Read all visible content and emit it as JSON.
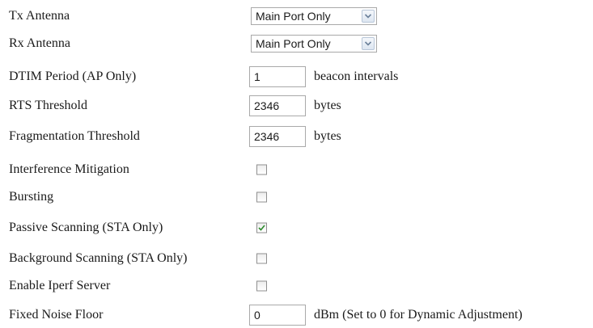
{
  "settings": {
    "tx_antenna": {
      "label": "Tx Antenna",
      "value": "Main Port Only"
    },
    "rx_antenna": {
      "label": "Rx Antenna",
      "value": "Main Port Only"
    },
    "dtim_period": {
      "label": "DTIM Period (AP Only)",
      "value": "1",
      "unit": "beacon intervals"
    },
    "rts_threshold": {
      "label": "RTS Threshold",
      "value": "2346",
      "unit": "bytes"
    },
    "fragmentation_threshold": {
      "label": "Fragmentation Threshold",
      "value": "2346",
      "unit": "bytes"
    },
    "interference_mitigation": {
      "label": "Interference Mitigation",
      "checked": false
    },
    "bursting": {
      "label": "Bursting",
      "checked": false
    },
    "passive_scanning": {
      "label": "Passive Scanning (STA Only)",
      "checked": true
    },
    "background_scanning": {
      "label": "Background Scanning (STA Only)",
      "checked": false
    },
    "enable_iperf_server": {
      "label": "Enable Iperf Server",
      "checked": false
    },
    "fixed_noise_floor": {
      "label": "Fixed Noise Floor",
      "value": "0",
      "unit": "dBm (Set to 0 for Dynamic Adjustment)"
    }
  },
  "icons": {
    "dropdown_arrow": "chevron-down-icon",
    "checkmark": "checkmark-icon"
  },
  "colors": {
    "checkmark": "#2e8b2e",
    "arrow": "#6a7f99"
  }
}
